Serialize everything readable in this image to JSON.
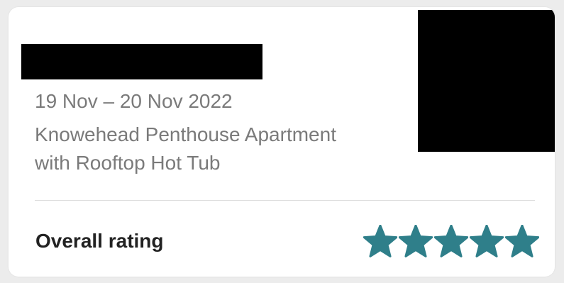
{
  "review_card": {
    "dates": "19 Nov – 20 Nov 2022",
    "listing_line1": "Knowehead Penthouse Apartment",
    "listing_line2": "with Rooftop Hot Tub",
    "rating_label": "Overall rating",
    "rating_stars": 5,
    "rating_max": 5,
    "star_color": "#2f7f8a",
    "redaction_color": "#000000"
  }
}
